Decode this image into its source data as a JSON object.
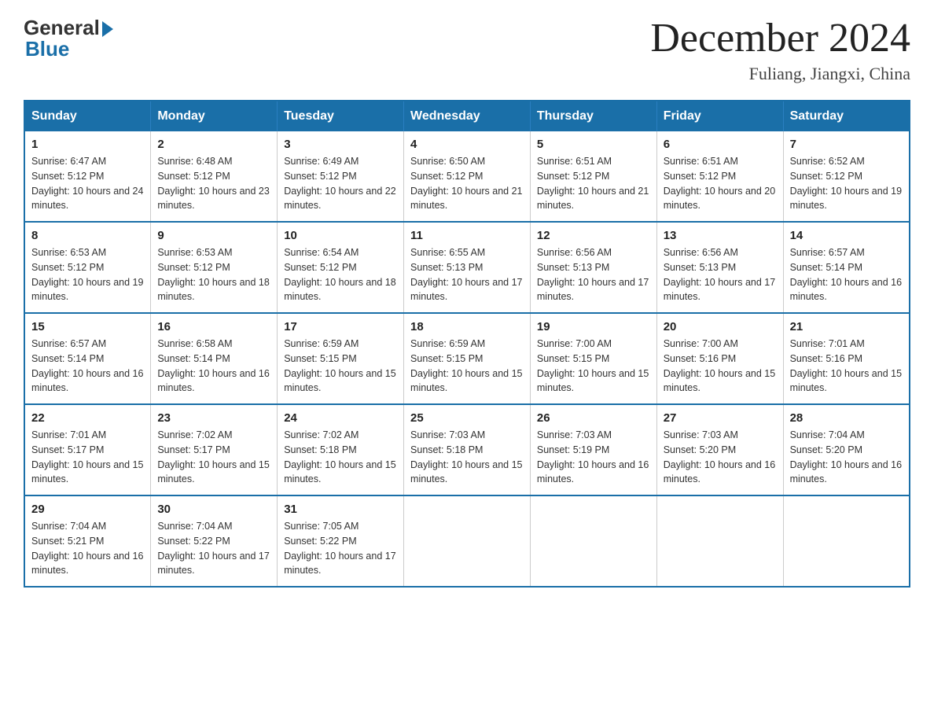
{
  "header": {
    "logo": {
      "general": "General",
      "blue": "Blue"
    },
    "title": "December 2024",
    "location": "Fuliang, Jiangxi, China"
  },
  "calendar": {
    "days_of_week": [
      "Sunday",
      "Monday",
      "Tuesday",
      "Wednesday",
      "Thursday",
      "Friday",
      "Saturday"
    ],
    "weeks": [
      [
        {
          "day": "1",
          "sunrise": "6:47 AM",
          "sunset": "5:12 PM",
          "daylight": "10 hours and 24 minutes."
        },
        {
          "day": "2",
          "sunrise": "6:48 AM",
          "sunset": "5:12 PM",
          "daylight": "10 hours and 23 minutes."
        },
        {
          "day": "3",
          "sunrise": "6:49 AM",
          "sunset": "5:12 PM",
          "daylight": "10 hours and 22 minutes."
        },
        {
          "day": "4",
          "sunrise": "6:50 AM",
          "sunset": "5:12 PM",
          "daylight": "10 hours and 21 minutes."
        },
        {
          "day": "5",
          "sunrise": "6:51 AM",
          "sunset": "5:12 PM",
          "daylight": "10 hours and 21 minutes."
        },
        {
          "day": "6",
          "sunrise": "6:51 AM",
          "sunset": "5:12 PM",
          "daylight": "10 hours and 20 minutes."
        },
        {
          "day": "7",
          "sunrise": "6:52 AM",
          "sunset": "5:12 PM",
          "daylight": "10 hours and 19 minutes."
        }
      ],
      [
        {
          "day": "8",
          "sunrise": "6:53 AM",
          "sunset": "5:12 PM",
          "daylight": "10 hours and 19 minutes."
        },
        {
          "day": "9",
          "sunrise": "6:53 AM",
          "sunset": "5:12 PM",
          "daylight": "10 hours and 18 minutes."
        },
        {
          "day": "10",
          "sunrise": "6:54 AM",
          "sunset": "5:12 PM",
          "daylight": "10 hours and 18 minutes."
        },
        {
          "day": "11",
          "sunrise": "6:55 AM",
          "sunset": "5:13 PM",
          "daylight": "10 hours and 17 minutes."
        },
        {
          "day": "12",
          "sunrise": "6:56 AM",
          "sunset": "5:13 PM",
          "daylight": "10 hours and 17 minutes."
        },
        {
          "day": "13",
          "sunrise": "6:56 AM",
          "sunset": "5:13 PM",
          "daylight": "10 hours and 17 minutes."
        },
        {
          "day": "14",
          "sunrise": "6:57 AM",
          "sunset": "5:14 PM",
          "daylight": "10 hours and 16 minutes."
        }
      ],
      [
        {
          "day": "15",
          "sunrise": "6:57 AM",
          "sunset": "5:14 PM",
          "daylight": "10 hours and 16 minutes."
        },
        {
          "day": "16",
          "sunrise": "6:58 AM",
          "sunset": "5:14 PM",
          "daylight": "10 hours and 16 minutes."
        },
        {
          "day": "17",
          "sunrise": "6:59 AM",
          "sunset": "5:15 PM",
          "daylight": "10 hours and 15 minutes."
        },
        {
          "day": "18",
          "sunrise": "6:59 AM",
          "sunset": "5:15 PM",
          "daylight": "10 hours and 15 minutes."
        },
        {
          "day": "19",
          "sunrise": "7:00 AM",
          "sunset": "5:15 PM",
          "daylight": "10 hours and 15 minutes."
        },
        {
          "day": "20",
          "sunrise": "7:00 AM",
          "sunset": "5:16 PM",
          "daylight": "10 hours and 15 minutes."
        },
        {
          "day": "21",
          "sunrise": "7:01 AM",
          "sunset": "5:16 PM",
          "daylight": "10 hours and 15 minutes."
        }
      ],
      [
        {
          "day": "22",
          "sunrise": "7:01 AM",
          "sunset": "5:17 PM",
          "daylight": "10 hours and 15 minutes."
        },
        {
          "day": "23",
          "sunrise": "7:02 AM",
          "sunset": "5:17 PM",
          "daylight": "10 hours and 15 minutes."
        },
        {
          "day": "24",
          "sunrise": "7:02 AM",
          "sunset": "5:18 PM",
          "daylight": "10 hours and 15 minutes."
        },
        {
          "day": "25",
          "sunrise": "7:03 AM",
          "sunset": "5:18 PM",
          "daylight": "10 hours and 15 minutes."
        },
        {
          "day": "26",
          "sunrise": "7:03 AM",
          "sunset": "5:19 PM",
          "daylight": "10 hours and 16 minutes."
        },
        {
          "day": "27",
          "sunrise": "7:03 AM",
          "sunset": "5:20 PM",
          "daylight": "10 hours and 16 minutes."
        },
        {
          "day": "28",
          "sunrise": "7:04 AM",
          "sunset": "5:20 PM",
          "daylight": "10 hours and 16 minutes."
        }
      ],
      [
        {
          "day": "29",
          "sunrise": "7:04 AM",
          "sunset": "5:21 PM",
          "daylight": "10 hours and 16 minutes."
        },
        {
          "day": "30",
          "sunrise": "7:04 AM",
          "sunset": "5:22 PM",
          "daylight": "10 hours and 17 minutes."
        },
        {
          "day": "31",
          "sunrise": "7:05 AM",
          "sunset": "5:22 PM",
          "daylight": "10 hours and 17 minutes."
        },
        null,
        null,
        null,
        null
      ]
    ]
  }
}
